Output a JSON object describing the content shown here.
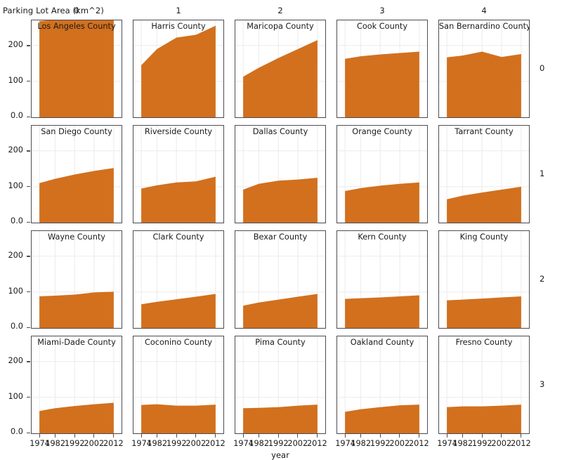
{
  "figure": {
    "y_axis_title": "Parking Lot Area (km^2)",
    "x_axis_title": "year",
    "area_color": "#d2701e",
    "panel_border_color": "#4d4d55",
    "grid_color": "#ebebeb"
  },
  "column_strips": [
    "0",
    "1",
    "2",
    "3",
    "4"
  ],
  "row_strips": [
    "0",
    "1",
    "2",
    "3"
  ],
  "axes": {
    "y_ticks": [
      "0.0",
      "100",
      "200"
    ],
    "y_tick_values": [
      0,
      100,
      200
    ],
    "y_limits": [
      0,
      270
    ],
    "x_ticks": [
      "1974",
      "1982",
      "1992",
      "2002",
      "2012"
    ],
    "x_tick_values": [
      1974,
      1982,
      1992,
      2002,
      2012
    ],
    "x_limits": [
      1970,
      2016
    ]
  },
  "chart_data": {
    "type": "area",
    "title": "Parking Lot Area (km^2)",
    "xlabel": "year",
    "ylabel": "Parking Lot Area (km^2)",
    "xlim": [
      1970,
      2016
    ],
    "ylim": [
      0,
      270
    ],
    "grid": true,
    "legend": "none",
    "facet_layout": {
      "rows": 4,
      "cols": 5,
      "row_labels": [
        "0",
        "1",
        "2",
        "3"
      ],
      "col_labels": [
        "0",
        "1",
        "2",
        "3",
        "4"
      ]
    },
    "x": [
      1974,
      1982,
      1992,
      2002,
      2012
    ],
    "panels": [
      {
        "name": "Los Angeles County",
        "row": 0,
        "col": 0,
        "values": [
          268,
          272,
          276,
          280,
          284
        ]
      },
      {
        "name": "Harris County",
        "row": 0,
        "col": 1,
        "values": [
          145,
          190,
          222,
          230,
          255
        ]
      },
      {
        "name": "Maricopa County",
        "row": 0,
        "col": 2,
        "values": [
          113,
          138,
          165,
          190,
          215
        ]
      },
      {
        "name": "Cook County",
        "row": 0,
        "col": 3,
        "values": [
          163,
          170,
          175,
          179,
          183
        ]
      },
      {
        "name": "San Bernardino County",
        "row": 0,
        "col": 4,
        "values": [
          167,
          172,
          183,
          168,
          176
        ]
      },
      {
        "name": "San Diego County",
        "row": 1,
        "col": 0,
        "values": [
          110,
          122,
          134,
          144,
          152
        ]
      },
      {
        "name": "Riverside County",
        "row": 1,
        "col": 1,
        "values": [
          95,
          104,
          112,
          115,
          128
        ]
      },
      {
        "name": "Dallas County",
        "row": 1,
        "col": 2,
        "values": [
          92,
          108,
          117,
          120,
          125
        ]
      },
      {
        "name": "Orange County",
        "row": 1,
        "col": 3,
        "values": [
          88,
          96,
          103,
          108,
          112
        ]
      },
      {
        "name": "Tarrant County",
        "row": 1,
        "col": 4,
        "values": [
          65,
          75,
          84,
          92,
          100
        ]
      },
      {
        "name": "Wayne County",
        "row": 2,
        "col": 0,
        "values": [
          88,
          90,
          93,
          99,
          101
        ]
      },
      {
        "name": "Clark County",
        "row": 2,
        "col": 1,
        "values": [
          66,
          73,
          80,
          87,
          95
        ]
      },
      {
        "name": "Bexar County",
        "row": 2,
        "col": 2,
        "values": [
          62,
          71,
          79,
          87,
          95
        ]
      },
      {
        "name": "Kern County",
        "row": 2,
        "col": 3,
        "values": [
          81,
          83,
          85,
          88,
          91
        ]
      },
      {
        "name": "King County",
        "row": 2,
        "col": 4,
        "values": [
          77,
          79,
          82,
          85,
          88
        ]
      },
      {
        "name": "Miami-Dade County",
        "row": 3,
        "col": 0,
        "values": [
          62,
          70,
          76,
          81,
          85
        ]
      },
      {
        "name": "Coconino County",
        "row": 3,
        "col": 1,
        "values": [
          79,
          81,
          77,
          77,
          80
        ]
      },
      {
        "name": "Pima County",
        "row": 3,
        "col": 2,
        "values": [
          70,
          71,
          73,
          77,
          80
        ]
      },
      {
        "name": "Oakland County",
        "row": 3,
        "col": 3,
        "values": [
          60,
          67,
          73,
          78,
          80
        ]
      },
      {
        "name": "Fresno County",
        "row": 3,
        "col": 4,
        "values": [
          73,
          75,
          75,
          77,
          80
        ]
      }
    ]
  }
}
